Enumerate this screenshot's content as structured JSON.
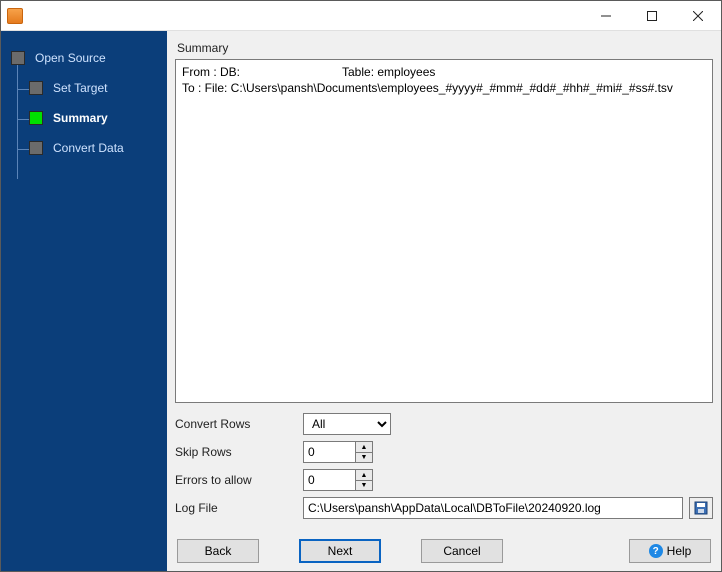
{
  "titlebar": {
    "title": ""
  },
  "sidebar": {
    "steps": [
      {
        "label": "Open Source"
      },
      {
        "label": "Set Target"
      },
      {
        "label": "Summary"
      },
      {
        "label": "Convert Data"
      }
    ]
  },
  "summary": {
    "heading": "Summary",
    "from_label": "From : DB:",
    "from_table": "Table: employees",
    "to_line": "To : File: C:\\Users\\pansh\\Documents\\employees_#yyyy#_#mm#_#dd#_#hh#_#mi#_#ss#.tsv"
  },
  "form": {
    "convert_rows_label": "Convert Rows",
    "convert_rows_value": "All",
    "skip_rows_label": "Skip Rows",
    "skip_rows_value": "0",
    "errors_label": "Errors to allow",
    "errors_value": "0",
    "log_file_label": "Log File",
    "log_file_value": "C:\\Users\\pansh\\AppData\\Local\\DBToFile\\20240920.log"
  },
  "buttons": {
    "back": "Back",
    "next": "Next",
    "cancel": "Cancel",
    "help": "Help"
  }
}
